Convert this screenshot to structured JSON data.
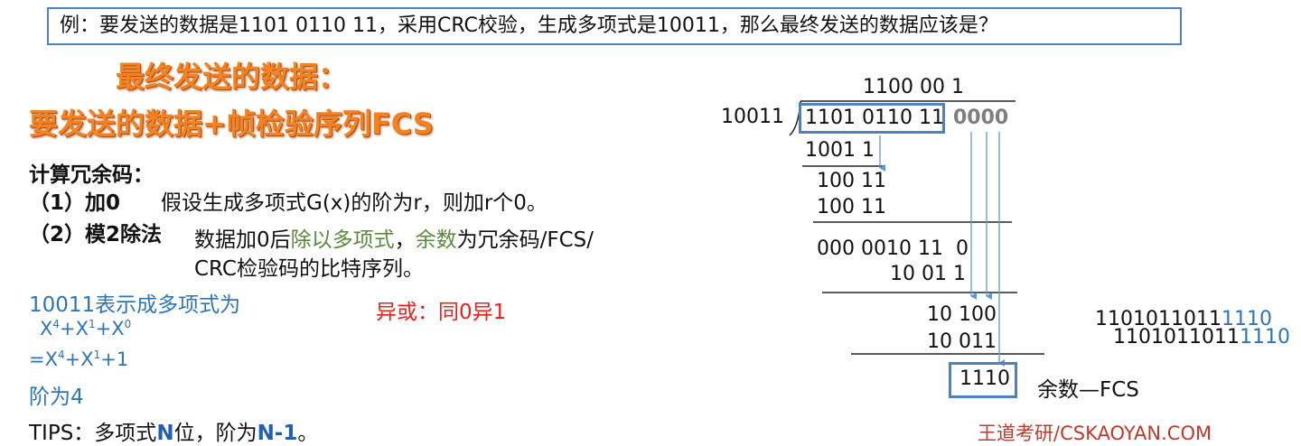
{
  "question": "例：要发送的数据是1101 0110 11，采用CRC校验，生成多项式是10011，那么最终发送的数据应该是？",
  "titles": {
    "line1": "最终发送的数据：",
    "line2": "要发送的数据+帧检验序列FCS"
  },
  "steps": {
    "heading": "计算冗余码：",
    "step1_label": "（1）加0",
    "step1_text": "假设生成多项式G(x)的阶为r，则加r个0。",
    "step2_label": "（2）模2除法",
    "step2_text_a": "数据加0后",
    "step2_text_b": "除以多项式",
    "step2_text_c": "，",
    "step2_text_d": "余数",
    "step2_text_e": "为冗余码/FCS/",
    "step2_text_line2": "CRC检验码的比特序列。"
  },
  "polynomial": {
    "intro": "10011表示成多项式为",
    "x": "X",
    "e4": "4",
    "e1": "1",
    "e0": "0",
    "plus": "+",
    "eq": "=",
    "one": "1",
    "degree": "阶为4"
  },
  "xor_rule": "异或：同0异1",
  "tips": {
    "prefix": "TIPS：多项式",
    "n": "N",
    "middle": "位，阶为",
    "n_minus_1": "N-1",
    "suffix": "。"
  },
  "division": {
    "divisor": "10011",
    "quotient": "1100 00 1",
    "dividend": "1101 0110 11",
    "appended_zeros": "0000",
    "rows": [
      "1001 1",
      "100 11",
      "100 11",
      "000 0010 11  0",
      "10 01 1",
      "10 100",
      "10 011"
    ],
    "remainder": "1110",
    "remainder_label": "余数—FCS"
  },
  "result": {
    "data_part": "1101011011",
    "fcs_part": "1110"
  },
  "watermark": "王道考研/CSKAOYAN.COM",
  "colors": {
    "accent_blue": "#2e75b6",
    "title_orange": "#f58220",
    "xor_red": "#e8211d",
    "green": "#5a8a3c"
  }
}
